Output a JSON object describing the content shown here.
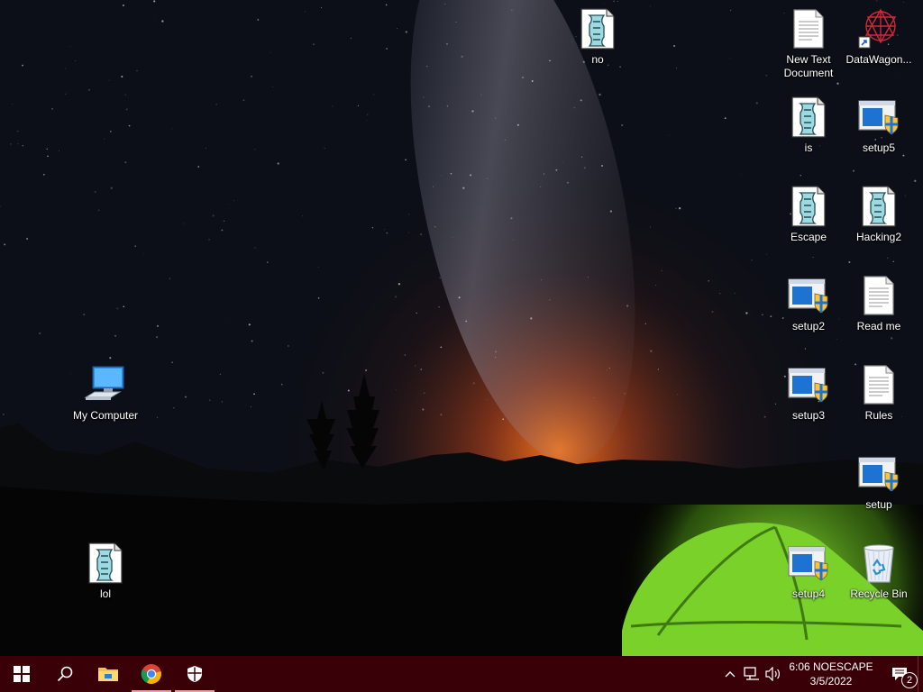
{
  "desktop": {
    "wallpaper": "night-sky-milky-way-with-glowing-green-tent",
    "icons": [
      {
        "id": "no",
        "label": "no",
        "type": "script-icon"
      },
      {
        "id": "new-text-document",
        "label": "New Text Document",
        "type": "text-document-icon"
      },
      {
        "id": "datawagon",
        "label": "DataWagon...",
        "type": "shortcut-icon"
      },
      {
        "id": "is",
        "label": "is",
        "type": "script-icon"
      },
      {
        "id": "setup5",
        "label": "setup5",
        "type": "installer-icon"
      },
      {
        "id": "escape",
        "label": "Escape",
        "type": "script-icon"
      },
      {
        "id": "hacking2",
        "label": "Hacking2",
        "type": "script-icon"
      },
      {
        "id": "setup2",
        "label": "setup2",
        "type": "installer-icon"
      },
      {
        "id": "read-me",
        "label": "Read me",
        "type": "text-document-icon"
      },
      {
        "id": "setup3",
        "label": "setup3",
        "type": "installer-icon"
      },
      {
        "id": "rules",
        "label": "Rules",
        "type": "text-document-icon"
      },
      {
        "id": "setup",
        "label": "setup",
        "type": "installer-icon"
      },
      {
        "id": "setup4",
        "label": "setup4",
        "type": "installer-icon"
      },
      {
        "id": "recycle-bin",
        "label": "Recycle Bin",
        "type": "recycle-bin-icon"
      },
      {
        "id": "my-computer",
        "label": "My Computer",
        "type": "computer-icon"
      },
      {
        "id": "lol",
        "label": "lol",
        "type": "script-icon"
      }
    ]
  },
  "taskbar": {
    "background": "#3a0007",
    "buttons": [
      {
        "name": "start",
        "icon": "windows-logo-icon"
      },
      {
        "name": "search",
        "icon": "search-icon"
      },
      {
        "name": "file-explorer",
        "icon": "folder-icon"
      },
      {
        "name": "chrome",
        "icon": "chrome-icon"
      },
      {
        "name": "security",
        "icon": "shield-icon"
      }
    ],
    "tray": {
      "icons": [
        "chevron-up-icon",
        "network-icon",
        "speaker-icon"
      ],
      "time": "6:06 NOESCAPE",
      "date": "3/5/2022",
      "notification_count": "2"
    }
  }
}
